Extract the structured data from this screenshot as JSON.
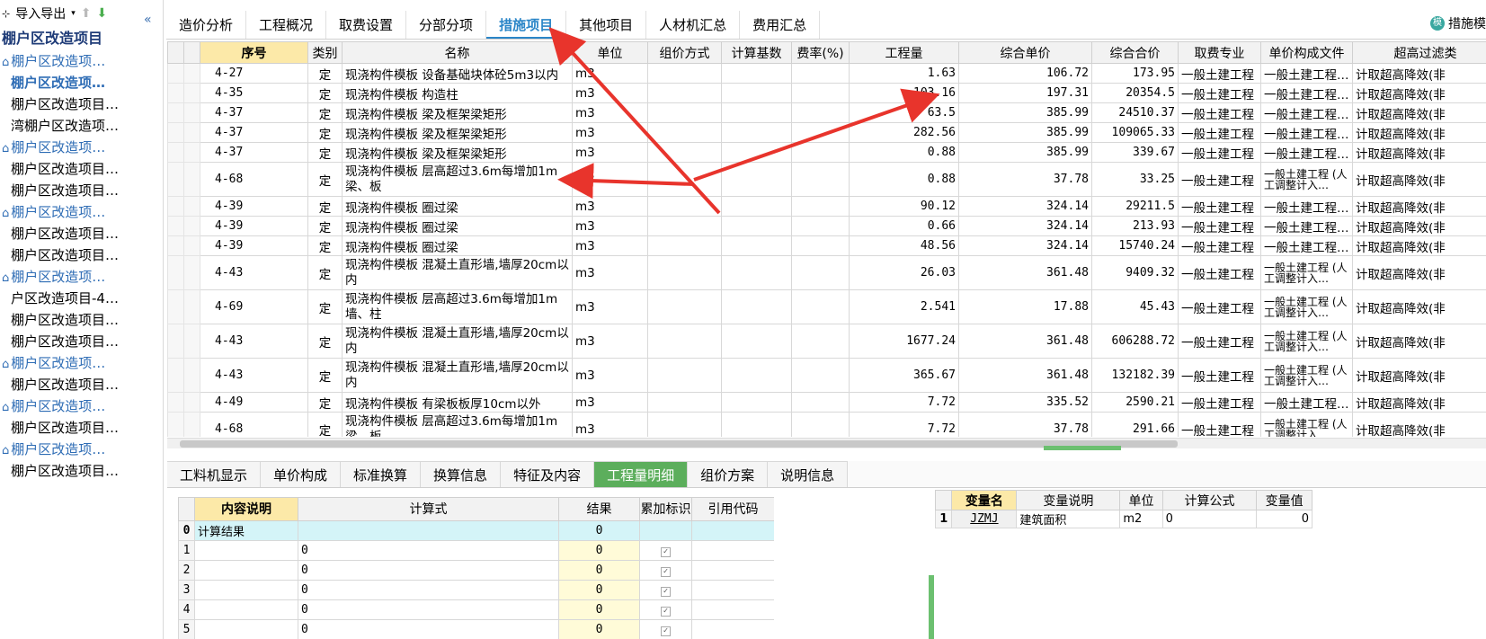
{
  "left": {
    "toolbar_label": "导入导出",
    "tree_root": "棚户区改造项目",
    "items": [
      {
        "label": "棚户区改造项…",
        "icon": true,
        "style": "blue"
      },
      {
        "label": "棚户区改造项…",
        "icon": false,
        "style": "sel"
      },
      {
        "label": "棚户区改造项目…",
        "icon": false,
        "style": ""
      },
      {
        "label": "湾棚户区改造项…",
        "icon": false,
        "style": ""
      },
      {
        "label": "棚户区改造项…",
        "icon": true,
        "style": "blue"
      },
      {
        "label": "棚户区改造项目…",
        "icon": false,
        "style": ""
      },
      {
        "label": "棚户区改造项目…",
        "icon": false,
        "style": ""
      },
      {
        "label": "棚户区改造项…",
        "icon": true,
        "style": "blue"
      },
      {
        "label": "棚户区改造项目…",
        "icon": false,
        "style": ""
      },
      {
        "label": "棚户区改造项目…",
        "icon": false,
        "style": ""
      },
      {
        "label": "棚户区改造项…",
        "icon": true,
        "style": "blue"
      },
      {
        "label": "户区改造项目-4…",
        "icon": false,
        "style": ""
      },
      {
        "label": "棚户区改造项目…",
        "icon": false,
        "style": ""
      },
      {
        "label": "棚户区改造项目…",
        "icon": false,
        "style": ""
      },
      {
        "label": "棚户区改造项…",
        "icon": true,
        "style": "blue"
      },
      {
        "label": "棚户区改造项目…",
        "icon": false,
        "style": ""
      },
      {
        "label": "棚户区改造项…",
        "icon": true,
        "style": "blue"
      },
      {
        "label": "棚户区改造项目…",
        "icon": false,
        "style": ""
      },
      {
        "label": "棚户区改造项…",
        "icon": true,
        "style": "blue"
      },
      {
        "label": "棚户区改造项目…",
        "icon": false,
        "style": ""
      }
    ]
  },
  "tabs": [
    "造价分析",
    "工程概况",
    "取费设置",
    "分部分项",
    "措施项目",
    "其他项目",
    "人材机汇总",
    "费用汇总"
  ],
  "active_tab": 4,
  "right_button": "措施模",
  "grid": {
    "headers": [
      "序号",
      "类别",
      "名称",
      "单位",
      "组价方式",
      "计算基数",
      "费率(%)",
      "工程量",
      "综合单价",
      "综合合价",
      "取费专业",
      "单价构成文件",
      "超高过滤类"
    ],
    "rows": [
      {
        "code": "4-27",
        "type": "定",
        "name": "现浇构件模板 设备基础块体砼5m3以内",
        "unit": "m3",
        "qty": "1.63",
        "price": "106.72",
        "total": "173.95",
        "spec": "一般土建工程",
        "file": "一般土建工程…",
        "filter": "计取超高降效(非",
        "tall": false
      },
      {
        "code": "4-35",
        "type": "定",
        "name": "现浇构件模板 构造柱",
        "unit": "m3",
        "qty": "103.16",
        "price": "197.31",
        "total": "20354.5",
        "spec": "一般土建工程",
        "file": "一般土建工程…",
        "filter": "计取超高降效(非",
        "tall": false
      },
      {
        "code": "4-37",
        "type": "定",
        "name": "现浇构件模板 梁及框架梁矩形",
        "unit": "m3",
        "qty": "63.5",
        "price": "385.99",
        "total": "24510.37",
        "spec": "一般土建工程",
        "file": "一般土建工程…",
        "filter": "计取超高降效(非",
        "tall": false
      },
      {
        "code": "4-37",
        "type": "定",
        "name": "现浇构件模板 梁及框架梁矩形",
        "unit": "m3",
        "qty": "282.56",
        "price": "385.99",
        "total": "109065.33",
        "spec": "一般土建工程",
        "file": "一般土建工程…",
        "filter": "计取超高降效(非",
        "tall": false
      },
      {
        "code": "4-37",
        "type": "定",
        "name": "现浇构件模板 梁及框架梁矩形",
        "unit": "m3",
        "qty": "0.88",
        "price": "385.99",
        "total": "339.67",
        "spec": "一般土建工程",
        "file": "一般土建工程…",
        "filter": "计取超高降效(非",
        "tall": false
      },
      {
        "code": "4-68",
        "type": "定",
        "name": "现浇构件模板 层高超过3.6m每增加1m 梁、板",
        "unit": "m3",
        "qty": "0.88",
        "price": "37.78",
        "total": "33.25",
        "spec": "一般土建工程",
        "file": "一般土建工程 (人工调整计入…",
        "filter": "计取超高降效(非",
        "tall": true
      },
      {
        "code": "4-39",
        "type": "定",
        "name": "现浇构件模板 圈过梁",
        "unit": "m3",
        "qty": "90.12",
        "price": "324.14",
        "total": "29211.5",
        "spec": "一般土建工程",
        "file": "一般土建工程…",
        "filter": "计取超高降效(非",
        "tall": false
      },
      {
        "code": "4-39",
        "type": "定",
        "name": "现浇构件模板 圈过梁",
        "unit": "m3",
        "qty": "0.66",
        "price": "324.14",
        "total": "213.93",
        "spec": "一般土建工程",
        "file": "一般土建工程…",
        "filter": "计取超高降效(非",
        "tall": false
      },
      {
        "code": "4-39",
        "type": "定",
        "name": "现浇构件模板 圈过梁",
        "unit": "m3",
        "qty": "48.56",
        "price": "324.14",
        "total": "15740.24",
        "spec": "一般土建工程",
        "file": "一般土建工程…",
        "filter": "计取超高降效(非",
        "tall": false
      },
      {
        "code": "4-43",
        "type": "定",
        "name": "现浇构件模板 混凝土直形墙,墙厚20cm以内",
        "unit": "m3",
        "qty": "26.03",
        "price": "361.48",
        "total": "9409.32",
        "spec": "一般土建工程",
        "file": "一般土建工程 (人工调整计入…",
        "filter": "计取超高降效(非",
        "tall": true
      },
      {
        "code": "4-69",
        "type": "定",
        "name": "现浇构件模板 层高超过3.6m每增加1m 墙、柱",
        "unit": "m3",
        "qty": "2.541",
        "price": "17.88",
        "total": "45.43",
        "spec": "一般土建工程",
        "file": "一般土建工程 (人工调整计入…",
        "filter": "计取超高降效(非",
        "tall": true
      },
      {
        "code": "4-43",
        "type": "定",
        "name": "现浇构件模板 混凝土直形墙,墙厚20cm以内",
        "unit": "m3",
        "qty": "1677.24",
        "price": "361.48",
        "total": "606288.72",
        "spec": "一般土建工程",
        "file": "一般土建工程 (人工调整计入…",
        "filter": "计取超高降效(非",
        "tall": true
      },
      {
        "code": "4-43",
        "type": "定",
        "name": "现浇构件模板 混凝土直形墙,墙厚20cm以内",
        "unit": "m3",
        "qty": "365.67",
        "price": "361.48",
        "total": "132182.39",
        "spec": "一般土建工程",
        "file": "一般土建工程 (人工调整计入…",
        "filter": "计取超高降效(非",
        "tall": true
      },
      {
        "code": "4-49",
        "type": "定",
        "name": "现浇构件模板 有梁板板厚10cm以外",
        "unit": "m3",
        "qty": "7.72",
        "price": "335.52",
        "total": "2590.21",
        "spec": "一般土建工程",
        "file": "一般土建工程…",
        "filter": "计取超高降效(非",
        "tall": false
      },
      {
        "code": "4-68",
        "type": "定",
        "name": "现浇构件模板 层高超过3.6m每增加1m 梁、板",
        "unit": "m3",
        "qty": "7.72",
        "price": "37.78",
        "total": "291.66",
        "spec": "一般土建工程",
        "file": "一般土建工程 (人工调整计入…",
        "filter": "计取超高降效(非",
        "tall": true
      }
    ]
  },
  "bottom_tabs": [
    "工料机显示",
    "单价构成",
    "标准换算",
    "换算信息",
    "特征及内容",
    "工程量明细",
    "组价方案",
    "说明信息"
  ],
  "bottom_active": 5,
  "calc": {
    "headers": [
      "内容说明",
      "计算式",
      "结果",
      "累加标识",
      "引用代码"
    ],
    "rows": [
      {
        "idx": "0",
        "desc": "计算结果",
        "expr": "",
        "result": "0",
        "check": false
      },
      {
        "idx": "1",
        "desc": "",
        "expr": "0",
        "result": "0",
        "check": true
      },
      {
        "idx": "2",
        "desc": "",
        "expr": "0",
        "result": "0",
        "check": true
      },
      {
        "idx": "3",
        "desc": "",
        "expr": "0",
        "result": "0",
        "check": true
      },
      {
        "idx": "4",
        "desc": "",
        "expr": "0",
        "result": "0",
        "check": true
      },
      {
        "idx": "5",
        "desc": "",
        "expr": "0",
        "result": "0",
        "check": true
      }
    ]
  },
  "vars": {
    "headers": [
      "变量名",
      "变量说明",
      "单位",
      "计算公式",
      "变量值"
    ],
    "rows": [
      {
        "idx": "1",
        "name": "JZMJ",
        "desc": "建筑面积",
        "unit": "m2",
        "formula": "0",
        "value": "0"
      }
    ]
  },
  "colors": {
    "accent": "#2b86c8",
    "arrow": "#e8342c",
    "green": "#5cae5c",
    "header_yellow": "#fce9a8"
  }
}
